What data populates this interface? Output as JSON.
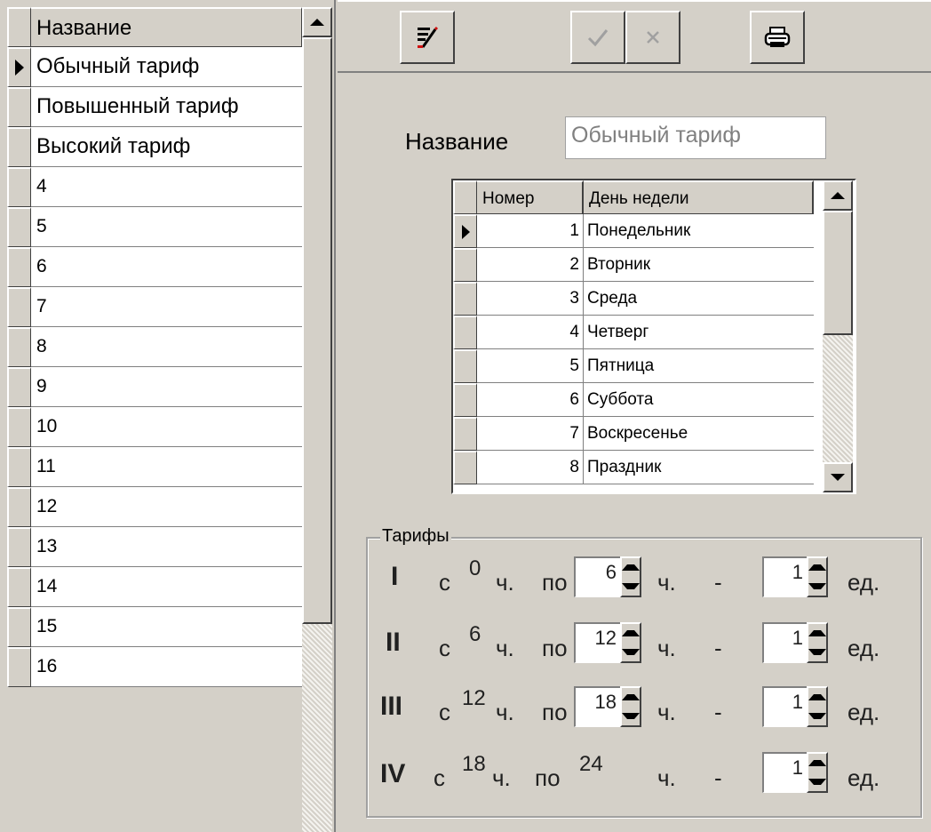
{
  "left_grid": {
    "header": "Название",
    "rows": [
      "Обычный тариф",
      "Повышенный тариф",
      "Высокий тариф",
      "4",
      "5",
      "6",
      "7",
      "8",
      "9",
      "10",
      "11",
      "12",
      "13",
      "14",
      "15",
      "16"
    ],
    "selected_index": 0
  },
  "toolbar": {
    "buttons": [
      "edit-icon",
      "check-icon",
      "cancel-icon",
      "print-icon"
    ]
  },
  "form": {
    "name_label": "Название",
    "name_value": "Обычный тариф"
  },
  "week_grid": {
    "headers": [
      "Номер",
      "День недели"
    ],
    "rows": [
      {
        "num": "1",
        "day": "Понедельник"
      },
      {
        "num": "2",
        "day": "Вторник"
      },
      {
        "num": "3",
        "day": "Среда"
      },
      {
        "num": "4",
        "day": "Четверг"
      },
      {
        "num": "5",
        "day": "Пятница"
      },
      {
        "num": "6",
        "day": "Суббота"
      },
      {
        "num": "7",
        "day": "Воскресенье"
      },
      {
        "num": "8",
        "day": "Праздник"
      }
    ],
    "selected_index": 0
  },
  "tariffs": {
    "title": "Тарифы",
    "from_word": "с",
    "hours_word": "ч.",
    "to_word": "по",
    "dash": "-",
    "units_word": "ед.",
    "rows": [
      {
        "roman": "I",
        "from": "0",
        "to": "6",
        "units": "1"
      },
      {
        "roman": "II",
        "from": "6",
        "to": "12",
        "units": "1"
      },
      {
        "roman": "III",
        "from": "12",
        "to": "18",
        "units": "1"
      },
      {
        "roman": "IV",
        "from": "18",
        "to": "24",
        "units": "1"
      }
    ]
  },
  "colors": {
    "face": "#d4d0c8",
    "window": "#ffffff",
    "shadow": "#808080",
    "disabled_text": "#808080"
  }
}
